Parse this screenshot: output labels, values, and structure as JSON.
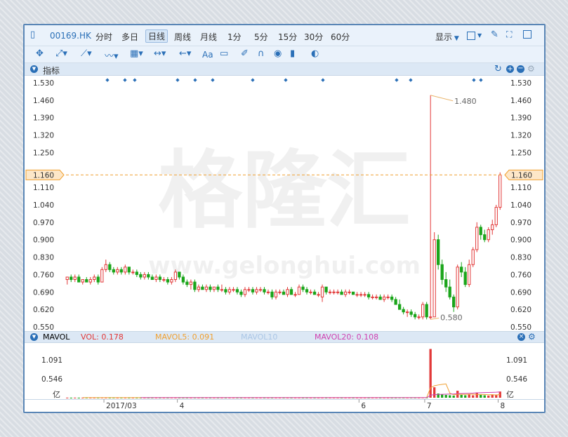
{
  "toolbar": {
    "ticker": "00169.HK",
    "periods": [
      "分时",
      "多日",
      "日线",
      "周线",
      "月线",
      "1分",
      "5分",
      "15分",
      "30分",
      "60分"
    ],
    "selected_period": "日线",
    "display_label": "显示",
    "text_tool_label": "Aa"
  },
  "indicator_bar": {
    "label": "指标"
  },
  "mavol_bar": {
    "title": "MAVOL",
    "vol": "VOL: 0.178",
    "mavol5": "MAVOL5: 0.091",
    "mavol10": "MAVOL10",
    "mavol20": "MAVOL20: 0.108"
  },
  "watermark": {
    "cn": "格隆汇",
    "en": "www.gelonghui.com"
  },
  "colors": {
    "up": "#e23838",
    "down": "#1aa51a",
    "accent": "#2a6fb7",
    "price_line": "#f0a030"
  },
  "price_axis": {
    "ticks": [
      "1.530",
      "1.460",
      "1.390",
      "1.320",
      "1.250",
      "1.160",
      "1.110",
      "1.040",
      "0.970",
      "0.900",
      "0.830",
      "0.760",
      "0.690",
      "0.620",
      "0.550"
    ],
    "current": "1.160"
  },
  "annotations": {
    "high": "1.480",
    "low": "0.580"
  },
  "volume_axis": {
    "ticks": [
      "1.091",
      "0.546"
    ],
    "unit": "亿"
  },
  "time_axis": {
    "labels": [
      "2017/03",
      "4",
      "6",
      "7",
      "8"
    ]
  },
  "chart_data": {
    "type": "candlestick",
    "title": "00169.HK",
    "ylim": [
      0.55,
      1.53
    ],
    "current_price": 1.16,
    "annotated_high": 1.48,
    "annotated_low": 0.58,
    "candles": [
      [
        0.74,
        0.75,
        0.72,
        0.75
      ],
      [
        0.75,
        0.76,
        0.73,
        0.74
      ],
      [
        0.74,
        0.76,
        0.73,
        0.75
      ],
      [
        0.75,
        0.76,
        0.73,
        0.73
      ],
      [
        0.73,
        0.74,
        0.72,
        0.74
      ],
      [
        0.74,
        0.75,
        0.73,
        0.73
      ],
      [
        0.73,
        0.75,
        0.72,
        0.74
      ],
      [
        0.74,
        0.76,
        0.73,
        0.75
      ],
      [
        0.75,
        0.76,
        0.72,
        0.73
      ],
      [
        0.73,
        0.79,
        0.73,
        0.78
      ],
      [
        0.78,
        0.82,
        0.77,
        0.8
      ],
      [
        0.8,
        0.81,
        0.77,
        0.78
      ],
      [
        0.78,
        0.79,
        0.76,
        0.77
      ],
      [
        0.77,
        0.79,
        0.76,
        0.78
      ],
      [
        0.78,
        0.79,
        0.76,
        0.77
      ],
      [
        0.77,
        0.8,
        0.76,
        0.79
      ],
      [
        0.79,
        0.79,
        0.76,
        0.77
      ],
      [
        0.77,
        0.78,
        0.76,
        0.77
      ],
      [
        0.77,
        0.78,
        0.75,
        0.76
      ],
      [
        0.76,
        0.77,
        0.74,
        0.75
      ],
      [
        0.75,
        0.77,
        0.74,
        0.76
      ],
      [
        0.76,
        0.77,
        0.74,
        0.75
      ],
      [
        0.75,
        0.76,
        0.74,
        0.74
      ],
      [
        0.74,
        0.76,
        0.73,
        0.75
      ],
      [
        0.75,
        0.76,
        0.73,
        0.74
      ],
      [
        0.74,
        0.75,
        0.73,
        0.74
      ],
      [
        0.74,
        0.75,
        0.72,
        0.73
      ],
      [
        0.73,
        0.75,
        0.72,
        0.74
      ],
      [
        0.74,
        0.78,
        0.73,
        0.77
      ],
      [
        0.77,
        0.77,
        0.74,
        0.75
      ],
      [
        0.75,
        0.76,
        0.72,
        0.73
      ],
      [
        0.73,
        0.74,
        0.71,
        0.72
      ],
      [
        0.72,
        0.74,
        0.7,
        0.73
      ],
      [
        0.73,
        0.74,
        0.69,
        0.7
      ],
      [
        0.7,
        0.72,
        0.69,
        0.71
      ],
      [
        0.71,
        0.72,
        0.7,
        0.7
      ],
      [
        0.7,
        0.72,
        0.69,
        0.71
      ],
      [
        0.71,
        0.72,
        0.69,
        0.7
      ],
      [
        0.7,
        0.71,
        0.69,
        0.71
      ],
      [
        0.71,
        0.72,
        0.69,
        0.7
      ],
      [
        0.7,
        0.72,
        0.69,
        0.7
      ],
      [
        0.7,
        0.71,
        0.68,
        0.69
      ],
      [
        0.69,
        0.71,
        0.68,
        0.7
      ],
      [
        0.7,
        0.71,
        0.69,
        0.7
      ],
      [
        0.7,
        0.71,
        0.68,
        0.69
      ],
      [
        0.69,
        0.7,
        0.67,
        0.68
      ],
      [
        0.68,
        0.71,
        0.67,
        0.7
      ],
      [
        0.7,
        0.71,
        0.69,
        0.7
      ],
      [
        0.7,
        0.71,
        0.68,
        0.69
      ],
      [
        0.69,
        0.71,
        0.68,
        0.7
      ],
      [
        0.7,
        0.71,
        0.69,
        0.7
      ],
      [
        0.7,
        0.71,
        0.68,
        0.69
      ],
      [
        0.69,
        0.7,
        0.68,
        0.69
      ],
      [
        0.69,
        0.7,
        0.66,
        0.67
      ],
      [
        0.67,
        0.7,
        0.66,
        0.69
      ],
      [
        0.69,
        0.7,
        0.68,
        0.69
      ],
      [
        0.69,
        0.7,
        0.68,
        0.68
      ],
      [
        0.68,
        0.71,
        0.67,
        0.7
      ],
      [
        0.7,
        0.71,
        0.68,
        0.68
      ],
      [
        0.68,
        0.69,
        0.67,
        0.68
      ],
      [
        0.68,
        0.72,
        0.68,
        0.71
      ],
      [
        0.71,
        0.72,
        0.69,
        0.7
      ],
      [
        0.7,
        0.71,
        0.68,
        0.69
      ],
      [
        0.69,
        0.7,
        0.68,
        0.69
      ],
      [
        0.69,
        0.7,
        0.68,
        0.68
      ],
      [
        0.68,
        0.69,
        0.67,
        0.68
      ],
      [
        0.67,
        0.72,
        0.65,
        0.71
      ],
      [
        0.71,
        0.71,
        0.68,
        0.69
      ],
      [
        0.69,
        0.7,
        0.68,
        0.69
      ],
      [
        0.69,
        0.7,
        0.68,
        0.69
      ],
      [
        0.69,
        0.7,
        0.68,
        0.69
      ],
      [
        0.69,
        0.7,
        0.68,
        0.68
      ],
      [
        0.68,
        0.7,
        0.67,
        0.69
      ],
      [
        0.69,
        0.7,
        0.68,
        0.69
      ],
      [
        0.69,
        0.69,
        0.68,
        0.68
      ],
      [
        0.68,
        0.69,
        0.67,
        0.68
      ],
      [
        0.68,
        0.69,
        0.67,
        0.68
      ],
      [
        0.68,
        0.69,
        0.67,
        0.68
      ],
      [
        0.68,
        0.69,
        0.66,
        0.67
      ],
      [
        0.67,
        0.68,
        0.66,
        0.67
      ],
      [
        0.67,
        0.68,
        0.66,
        0.67
      ],
      [
        0.67,
        0.68,
        0.66,
        0.66
      ],
      [
        0.66,
        0.68,
        0.65,
        0.67
      ],
      [
        0.67,
        0.68,
        0.66,
        0.67
      ],
      [
        0.67,
        0.68,
        0.65,
        0.66
      ],
      [
        0.66,
        0.67,
        0.64,
        0.64
      ],
      [
        0.64,
        0.66,
        0.62,
        0.62
      ],
      [
        0.62,
        0.63,
        0.6,
        0.61
      ],
      [
        0.61,
        0.62,
        0.59,
        0.61
      ],
      [
        0.61,
        0.62,
        0.59,
        0.6
      ],
      [
        0.6,
        0.61,
        0.58,
        0.59
      ],
      [
        0.59,
        0.6,
        0.58,
        0.59
      ],
      [
        0.59,
        0.65,
        0.58,
        0.64
      ],
      [
        0.64,
        0.65,
        0.58,
        0.59
      ],
      [
        0.59,
        1.48,
        0.58,
        0.59
      ],
      [
        0.59,
        0.93,
        0.59,
        0.9
      ],
      [
        0.9,
        0.92,
        0.78,
        0.8
      ],
      [
        0.8,
        0.82,
        0.72,
        0.74
      ],
      [
        0.74,
        0.77,
        0.69,
        0.71
      ],
      [
        0.71,
        0.74,
        0.66,
        0.67
      ],
      [
        0.67,
        0.68,
        0.61,
        0.63
      ],
      [
        0.63,
        0.8,
        0.62,
        0.79
      ],
      [
        0.79,
        0.81,
        0.75,
        0.77
      ],
      [
        0.77,
        0.79,
        0.71,
        0.72
      ],
      [
        0.72,
        0.82,
        0.71,
        0.8
      ],
      [
        0.8,
        0.87,
        0.79,
        0.86
      ],
      [
        0.86,
        0.97,
        0.85,
        0.95
      ],
      [
        0.95,
        0.96,
        0.9,
        0.92
      ],
      [
        0.92,
        0.94,
        0.89,
        0.9
      ],
      [
        0.9,
        0.95,
        0.89,
        0.94
      ],
      [
        0.94,
        0.98,
        0.92,
        0.96
      ],
      [
        0.96,
        1.04,
        0.95,
        1.03
      ],
      [
        1.03,
        1.17,
        1.02,
        1.16
      ]
    ],
    "volume": [
      0.003,
      0.002,
      0.003,
      0.002,
      0.002,
      0.003,
      0.002,
      0.002,
      0.003,
      0.004,
      0.002,
      0.002,
      0.003,
      0.002,
      0.003,
      0.002,
      0.002,
      0.002,
      0.002,
      0.003,
      0.002,
      0.002,
      0.002,
      0.002,
      0.002,
      0.002,
      0.002,
      0.003,
      0.002,
      0.002,
      0.002,
      0.002,
      0.002,
      0.003,
      0.002,
      0.002,
      0.002,
      0.002,
      0.002,
      0.002,
      0.002,
      0.002,
      0.002,
      0.002,
      0.002,
      0.002,
      0.002,
      0.002,
      0.002,
      0.002,
      0.002,
      0.002,
      0.002,
      0.002,
      0.002,
      0.002,
      0.002,
      0.002,
      0.002,
      0.002,
      0.002,
      0.002,
      0.002,
      0.002,
      0.002,
      0.002,
      0.002,
      0.002,
      0.002,
      0.002,
      0.002,
      0.002,
      0.002,
      0.002,
      0.002,
      0.002,
      0.002,
      0.002,
      0.002,
      0.002,
      0.002,
      0.002,
      0.002,
      0.002,
      0.002,
      0.002,
      0.004,
      0.003,
      0.003,
      0.004,
      0.003,
      0.003,
      0.005,
      0.006,
      1.4,
      0.3,
      0.12,
      0.09,
      0.08,
      0.07,
      0.06,
      0.2,
      0.08,
      0.07,
      0.09,
      0.07,
      0.15,
      0.08,
      0.07,
      0.06,
      0.08,
      0.09,
      0.178
    ],
    "mavol5": [],
    "volume_ylim": [
      0,
      1.45
    ]
  }
}
